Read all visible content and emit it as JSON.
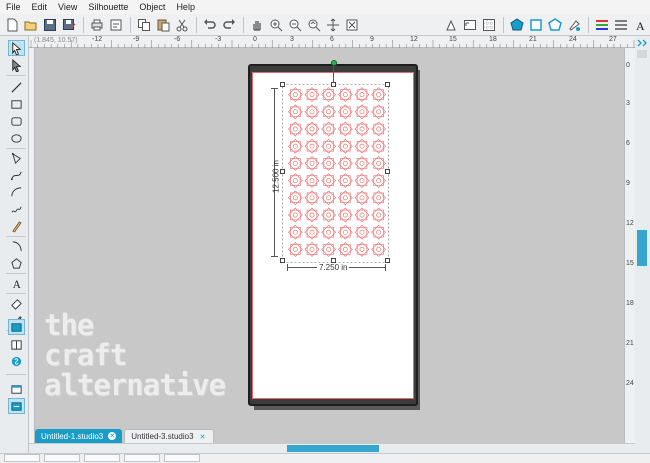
{
  "menu": [
    "File",
    "Edit",
    "View",
    "Silhouette",
    "Object",
    "Help"
  ],
  "toolbar": {
    "left_icons": [
      "new-icon",
      "open-icon",
      "save-icon",
      "save-as-icon",
      "print-icon",
      "cut-settings-icon",
      "copy-icon",
      "paste-icon",
      "cut-icon",
      "undo-icon",
      "redo-icon",
      "pan-icon",
      "zoom-in-icon",
      "zoom-out-icon",
      "zoom-drag-icon",
      "zoom-fit-icon",
      "fit-page-icon"
    ],
    "right_icons": [
      "page-setup-icon",
      "registration-icon",
      "grid-icon",
      "align-icon",
      "replicate-icon",
      "transform-icon",
      "fill-color-icon",
      "line-color-icon",
      "line-style-icon",
      "text-style-icon"
    ]
  },
  "ruler": {
    "coords": "(1.845, 10.57)",
    "top_numbers": [
      "-12",
      "-9",
      "-6",
      "-3",
      "0",
      "3",
      "6",
      "9",
      "12",
      "15",
      "18",
      "21",
      "24",
      "27"
    ],
    "right_numbers": [
      "0",
      "3",
      "6",
      "9",
      "12",
      "15",
      "18",
      "21",
      "24"
    ]
  },
  "left_tools": [
    "select-icon",
    "edit-points-icon",
    "line-icon",
    "rectangle-icon",
    "rounded-rect-icon",
    "ellipse-icon",
    "polygon-icon",
    "curve-icon",
    "arc-icon",
    "freehand-icon",
    "smooth-freehand-icon",
    "arc-tool-icon",
    "regular-polygon-icon",
    "text-icon",
    "eraser-icon",
    "knife-icon",
    "design-view-icon",
    "library-icon",
    "store-icon",
    "cut-view-icon",
    "send-icon"
  ],
  "selection": {
    "height_label": "12.500 in",
    "width_label": "7.250 in"
  },
  "watermark": {
    "line1": "the",
    "line2": "craft",
    "line3": "alternative"
  },
  "tabs": [
    {
      "label": "Untitled-1.studio3",
      "active": true
    },
    {
      "label": "Untitled-3.studio3",
      "active": false
    }
  ],
  "colors": {
    "accent": "#1a9cc9",
    "pattern": "#e87878",
    "paper_border": "#e36b6b",
    "mat": "#3c3c3c"
  }
}
